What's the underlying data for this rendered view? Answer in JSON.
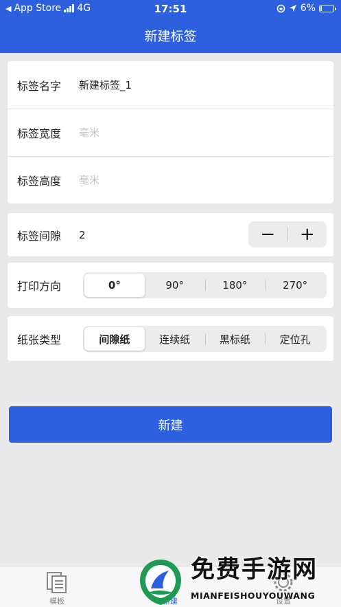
{
  "status_bar": {
    "back_app": "App Store",
    "network": "4G",
    "time": "17:51",
    "battery": "6%"
  },
  "nav": {
    "title": "新建标签"
  },
  "label_form": {
    "name": {
      "label": "标签名字",
      "value": "新建标签_1"
    },
    "width": {
      "label": "标签宽度",
      "placeholder": "毫米"
    },
    "height": {
      "label": "标签高度",
      "placeholder": "毫米"
    }
  },
  "gap": {
    "label": "标签间隙",
    "value": "2",
    "minus": "−",
    "plus": "+"
  },
  "print_direction": {
    "label": "打印方向",
    "options": [
      "0°",
      "90°",
      "180°",
      "270°"
    ],
    "selected": "0°"
  },
  "paper_type": {
    "label": "纸张类型",
    "options": [
      "间隙纸",
      "连续纸",
      "黑标纸",
      "定位孔"
    ],
    "selected": "间隙纸"
  },
  "create_button": {
    "label": "新建"
  },
  "tab_bar": {
    "tabs": [
      {
        "label": "模板",
        "icon": "document-icon"
      },
      {
        "label": "新建",
        "icon": "add-icon"
      },
      {
        "label": "设置",
        "icon": "gear-icon"
      }
    ],
    "active": "新建"
  },
  "watermark": {
    "title": "免费手游网",
    "subtitle": "MIANFEISHOUYOUWANG"
  },
  "colors": {
    "primary": "#2e5fdf",
    "background": "#e9e9e9"
  }
}
